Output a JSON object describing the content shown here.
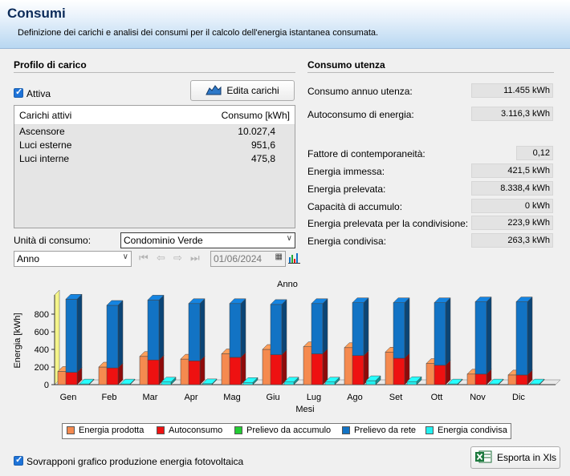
{
  "header": {
    "title": "Consumi",
    "subtitle": "Definizione dei carichi e analisi dei consumi per il calcolo dell'energia istantanea consumata."
  },
  "profilo": {
    "section_title": "Profilo di carico",
    "attiva_label": "Attiva",
    "edit_button_label": "Edita carichi",
    "list_headers": [
      "Carichi attivi",
      "Consumo [kWh]"
    ],
    "list_items": [
      {
        "name": "Ascensore",
        "value": "10.027,4"
      },
      {
        "name": "Luci esterne",
        "value": "951,6"
      },
      {
        "name": "Luci interne",
        "value": "475,8"
      }
    ],
    "unita_label": "Unità di consumo:",
    "unita_value": "Condominio Verde",
    "period_value": "Anno",
    "date_value": "01/06/2024"
  },
  "consumo": {
    "section_title": "Consumo utenza",
    "rows": [
      {
        "label": "Consumo annuo utenza:",
        "value": "11.455 kWh"
      },
      {
        "label": "Autoconsumo di energia:",
        "value": "3.116,3 kWh"
      },
      {
        "label": "Fattore di contemporaneità:",
        "value": "0,12"
      },
      {
        "label": "Energia immessa:",
        "value": "421,5 kWh"
      },
      {
        "label": "Energia prelevata:",
        "value": "8.338,4 kWh"
      },
      {
        "label": "Capacità di accumulo:",
        "value": "0 kWh"
      },
      {
        "label": "Energia prelevata per la condivisione:",
        "value": "223,9 kWh"
      },
      {
        "label": "Energia condivisa:",
        "value": "263,3 kWh"
      }
    ]
  },
  "chart_data": {
    "type": "bar",
    "title": "Anno",
    "xlabel": "Mesi",
    "ylabel": "Energia [kWh]",
    "ylim": [
      0,
      1000
    ],
    "yticks": [
      "0",
      "200",
      "400",
      "600",
      "800"
    ],
    "categories": [
      "Gen",
      "Feb",
      "Mar",
      "Apr",
      "Mag",
      "Giu",
      "Lug",
      "Ago",
      "Set",
      "Ott",
      "Nov",
      "Dic"
    ],
    "series": [
      {
        "name": "Energia prodotta",
        "color": "#f58a4f",
        "values": [
          150,
          200,
          320,
          290,
          350,
          400,
          430,
          420,
          370,
          240,
          120,
          110
        ]
      },
      {
        "name": "Autoconsumo",
        "color": "#ee1111",
        "values": [
          140,
          190,
          280,
          270,
          310,
          340,
          350,
          330,
          300,
          220,
          120,
          110
        ]
      },
      {
        "name": "Prelievo da accumulo",
        "color": "#22cc33",
        "values": [
          0,
          0,
          0,
          0,
          0,
          0,
          0,
          0,
          0,
          0,
          0,
          0
        ]
      },
      {
        "name": "Prelievo da rete",
        "color": "#1273c4",
        "values": [
          830,
          710,
          680,
          650,
          610,
          570,
          570,
          600,
          630,
          710,
          820,
          830
        ]
      },
      {
        "name": "Energia condivisa",
        "color": "#22f0f0",
        "values": [
          0,
          0,
          30,
          10,
          25,
          30,
          30,
          45,
          35,
          0,
          0,
          0
        ]
      }
    ]
  },
  "overlay_label": "Sovrapponi grafico produzione energia fotovoltaica",
  "export_label": "Esporta in Xls"
}
